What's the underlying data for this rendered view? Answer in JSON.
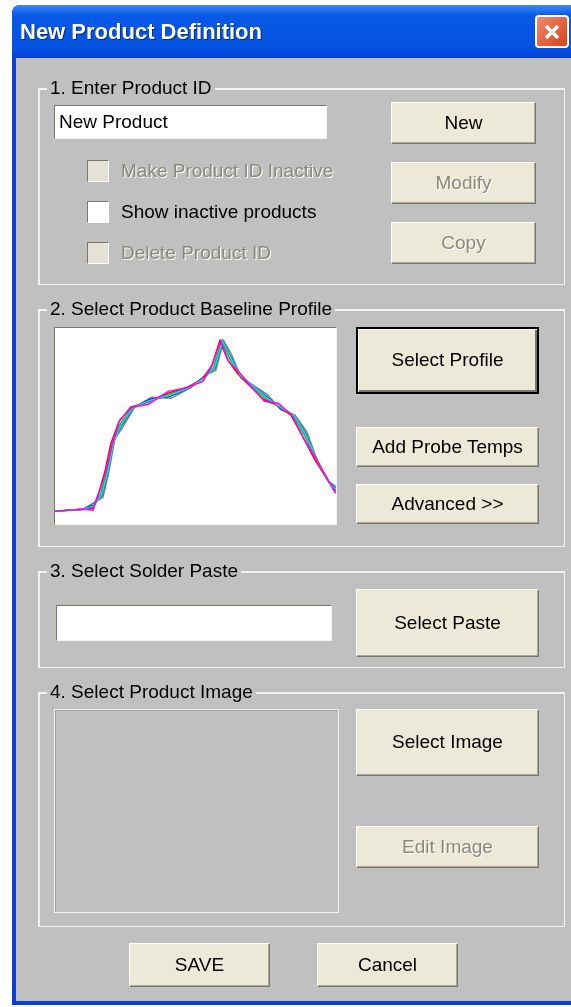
{
  "window": {
    "title": "New Product Definition"
  },
  "product_id": {
    "title": "1. Enter Product ID",
    "field": {
      "value": "New Product"
    },
    "checkboxes": [
      {
        "label": "Make Product ID Inactive",
        "checked": false,
        "disabled": true
      },
      {
        "label": "Show inactive products",
        "checked": false,
        "disabled": false
      },
      {
        "label": "Delete Product ID",
        "checked": false,
        "disabled": true
      }
    ],
    "buttons": [
      {
        "label": "New",
        "disabled": false,
        "default": false
      },
      {
        "label": "Modify",
        "disabled": true,
        "default": false
      },
      {
        "label": "Copy",
        "disabled": true,
        "default": false
      }
    ]
  },
  "profile": {
    "title": "2. Select Product Baseline Profile",
    "buttons": [
      {
        "label": "Select Profile",
        "disabled": false,
        "default": true
      },
      {
        "label": "Add Probe Temps",
        "disabled": false,
        "default": false
      },
      {
        "label": "Advanced >>",
        "disabled": false,
        "default": false
      }
    ]
  },
  "solder_paste": {
    "title": "3. Select Solder Paste",
    "buttons": [
      {
        "label": "Select Paste",
        "disabled": false,
        "default": false
      }
    ]
  },
  "product_image": {
    "title": "4. Select Product Image",
    "buttons": [
      {
        "label": "Select Image",
        "disabled": false,
        "default": false
      },
      {
        "label": "Edit Image",
        "disabled": true,
        "default": false
      }
    ]
  },
  "footer_buttons": [
    {
      "label": "SAVE",
      "disabled": false,
      "default": false
    },
    {
      "label": "Cancel",
      "disabled": false,
      "default": false
    }
  ]
}
